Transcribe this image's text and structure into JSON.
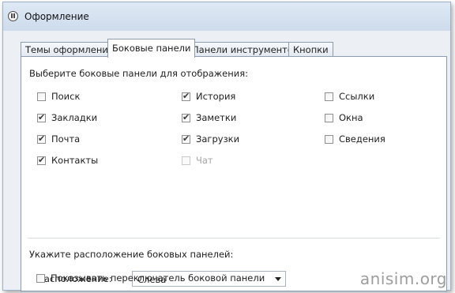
{
  "window": {
    "title": "Оформление"
  },
  "tabs": [
    {
      "label": "Темы оформления",
      "active": false
    },
    {
      "label": "Боковые панели",
      "active": true
    },
    {
      "label": "Панели инструментов",
      "active": false
    },
    {
      "label": "Кнопки",
      "active": false
    }
  ],
  "panels_section": {
    "heading": "Выберите боковые панели для отображения:",
    "checkboxes": [
      {
        "label": "Поиск",
        "checked": false,
        "disabled": false
      },
      {
        "label": "Закладки",
        "checked": true,
        "disabled": false
      },
      {
        "label": "Почта",
        "checked": true,
        "disabled": false
      },
      {
        "label": "Контакты",
        "checked": true,
        "disabled": false
      },
      {
        "label": "История",
        "checked": true,
        "disabled": false
      },
      {
        "label": "Заметки",
        "checked": true,
        "disabled": false
      },
      {
        "label": "Загрузки",
        "checked": true,
        "disabled": false
      },
      {
        "label": "Чат",
        "checked": false,
        "disabled": true
      },
      {
        "label": "Ссылки",
        "checked": false,
        "disabled": false
      },
      {
        "label": "Окна",
        "checked": false,
        "disabled": false
      },
      {
        "label": "Сведения",
        "checked": false,
        "disabled": false
      }
    ]
  },
  "position_section": {
    "heading": "Укажите расположение боковых панелей:",
    "position_label": "Расположение:",
    "position_value": "Слева",
    "show_switcher": {
      "label": "Показывать переключатель боковой панели",
      "checked": false
    }
  },
  "watermark": "anisim.org"
}
